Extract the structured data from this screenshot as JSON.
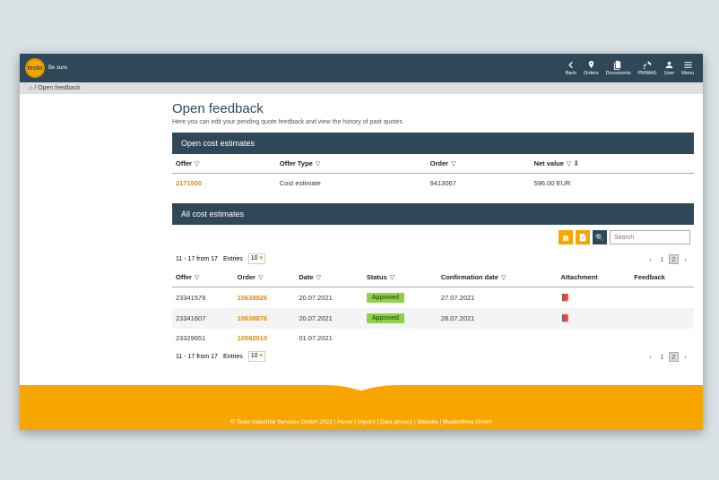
{
  "brand": {
    "logo_text": "testo",
    "tagline": "Be sure."
  },
  "nav": {
    "back": "Back",
    "orders": "Orders",
    "documents": "Documents",
    "primas": "PRIMAS",
    "user": "User",
    "menu": "Menu"
  },
  "breadcrumb": {
    "home_glyph": "⌂",
    "sep": "/",
    "current": "Open feedback"
  },
  "page": {
    "title": "Open feedback",
    "subtitle": "Here you can edit your pending quote feedback and view the history of past quotes"
  },
  "panel_open": {
    "title": "Open cost estimates",
    "cols": {
      "offer": "Offer",
      "offer_type": "Offer Type",
      "order": "Order",
      "net_value": "Net value"
    },
    "row": {
      "offer": "2171500",
      "offer_type": "Cost estimate",
      "order": "9413067",
      "net_value": "596.00 EUR"
    }
  },
  "panel_all": {
    "title": "All cost estimates",
    "search_placeholder": "Search",
    "pager_info": "11 - 17 from 17",
    "entries_label": "Entries",
    "entries_value": "10",
    "pages": {
      "prev": "‹",
      "p1": "1",
      "p2": "2",
      "next": "›"
    },
    "cols": {
      "offer": "Offer",
      "order": "Order",
      "date": "Date",
      "status": "Status",
      "confirmation": "Confirmation date",
      "attachment": "Attachment",
      "feedback": "Feedback"
    },
    "rows": [
      {
        "offer": "23341579",
        "order": "10638926",
        "date": "20.07.2021",
        "status": "Approved",
        "confirmation": "27.07.2021",
        "attachment": "pdf"
      },
      {
        "offer": "23341607",
        "order": "10638876",
        "date": "20.07.2021",
        "status": "Approved",
        "confirmation": "28.07.2021",
        "attachment": "pdf"
      },
      {
        "offer": "23329651",
        "order": "10592010",
        "date": "01.07.2021",
        "status": "",
        "confirmation": "",
        "attachment": ""
      }
    ]
  },
  "footer": "© Testo Industrial Services GmbH 2022 | Home | Imprint | Data privacy | Website | Musterfirma GmbH"
}
